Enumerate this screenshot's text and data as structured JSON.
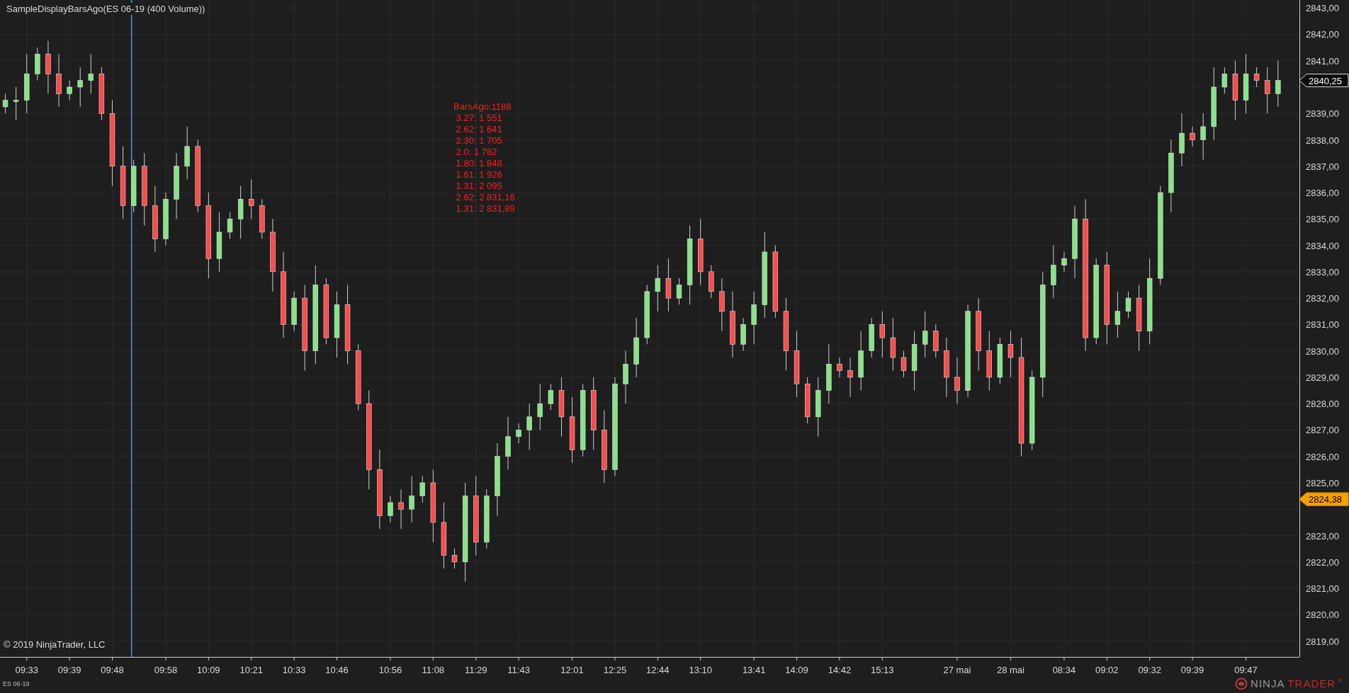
{
  "chart_title": "SampleDisplayBarsAgo(ES 06-19 (400 Volume))",
  "overlay_lines": [
    "BarsAgo:1188",
    " 3.27: 1 551",
    " 2.62: 1 641",
    " 2.30: 1 705",
    " 2.0: 1 782",
    " 1.80: 1 848",
    " 1.61: 1 926",
    " 1.31: 2 095",
    " 2.62: 2 831,16",
    " 1.31: 2 831,89"
  ],
  "copyright": "© 2019 NinjaTrader, LLC",
  "logo": {
    "part_1": "NINJA",
    "part_2": "TRADER",
    "mark": "®"
  },
  "chart_data": {
    "type": "candlestick",
    "grid": true,
    "ylim": [
      2818.4,
      2843.3
    ],
    "categories": [
      null,
      null,
      "09:33",
      null,
      null,
      null,
      "09:39",
      null,
      null,
      null,
      "09:48",
      null,
      null,
      null,
      null,
      "09:58",
      null,
      null,
      null,
      "10:09",
      null,
      null,
      null,
      "10:21",
      null,
      null,
      null,
      "10:33",
      null,
      null,
      null,
      "10:46",
      null,
      null,
      null,
      null,
      "10:56",
      null,
      null,
      null,
      "11:08",
      null,
      null,
      null,
      "11:29",
      null,
      null,
      null,
      "11:43",
      null,
      null,
      null,
      null,
      "12:01",
      null,
      null,
      null,
      "12:25",
      null,
      null,
      null,
      "12:44",
      null,
      null,
      null,
      "13:10",
      null,
      null,
      null,
      null,
      "13:41",
      null,
      null,
      null,
      "14:09",
      null,
      null,
      null,
      "14:42",
      null,
      null,
      null,
      "15:13",
      null,
      null,
      null,
      null,
      null,
      null,
      "27 mai",
      null,
      null,
      null,
      null,
      "28 mai",
      null,
      null,
      null,
      null,
      "08:34",
      null,
      null,
      null,
      "09:02",
      null,
      null,
      null,
      "09:32",
      null,
      null,
      null,
      "09:39",
      null,
      null,
      null,
      null,
      "09:47",
      null,
      null,
      null
    ],
    "series": [
      {
        "name": "ES 06-19",
        "ohlc": [
          [
            2839.25,
            2839.75,
            2839.0,
            2839.5
          ],
          [
            2839.5,
            2840.0,
            2838.75,
            2839.5
          ],
          [
            2839.5,
            2841.25,
            2839.0,
            2840.5
          ],
          [
            2840.5,
            2841.5,
            2840.25,
            2841.25
          ],
          [
            2841.25,
            2841.75,
            2839.75,
            2840.5
          ],
          [
            2840.5,
            2841.25,
            2839.25,
            2839.75
          ],
          [
            2839.75,
            2840.25,
            2839.5,
            2840.0
          ],
          [
            2840.0,
            2840.75,
            2839.25,
            2840.25
          ],
          [
            2840.25,
            2841.25,
            2839.75,
            2840.5
          ],
          [
            2840.5,
            2840.75,
            2838.75,
            2839.0
          ],
          [
            2839.0,
            2839.5,
            2836.25,
            2837.0
          ],
          [
            2837.0,
            2837.75,
            2835.0,
            2835.5
          ],
          [
            2835.5,
            2837.25,
            2835.25,
            2837.0
          ],
          [
            2837.0,
            2837.5,
            2834.75,
            2835.5
          ],
          [
            2835.5,
            2836.25,
            2833.75,
            2834.25
          ],
          [
            2834.25,
            2836.0,
            2834.0,
            2835.75
          ],
          [
            2835.75,
            2837.5,
            2835.0,
            2837.0
          ],
          [
            2837.0,
            2838.5,
            2836.5,
            2837.75
          ],
          [
            2837.75,
            2838.0,
            2835.25,
            2835.5
          ],
          [
            2835.5,
            2836.0,
            2832.75,
            2833.5
          ],
          [
            2833.5,
            2835.25,
            2833.0,
            2834.5
          ],
          [
            2834.5,
            2835.25,
            2834.25,
            2835.0
          ],
          [
            2835.0,
            2836.25,
            2834.25,
            2835.75
          ],
          [
            2835.75,
            2836.5,
            2835.0,
            2835.5
          ],
          [
            2835.5,
            2835.75,
            2834.25,
            2834.5
          ],
          [
            2834.5,
            2835.0,
            2832.25,
            2833.0
          ],
          [
            2833.0,
            2833.75,
            2830.5,
            2831.0
          ],
          [
            2831.0,
            2832.25,
            2830.75,
            2832.0
          ],
          [
            2832.0,
            2832.5,
            2829.25,
            2830.0
          ],
          [
            2830.0,
            2833.25,
            2829.5,
            2832.5
          ],
          [
            2832.5,
            2832.75,
            2830.25,
            2830.5
          ],
          [
            2830.5,
            2832.25,
            2829.75,
            2831.75
          ],
          [
            2831.75,
            2832.5,
            2829.5,
            2830.0
          ],
          [
            2830.0,
            2830.25,
            2827.75,
            2828.0
          ],
          [
            2828.0,
            2828.5,
            2824.75,
            2825.5
          ],
          [
            2825.5,
            2826.25,
            2823.25,
            2823.75
          ],
          [
            2823.75,
            2824.5,
            2823.5,
            2824.25
          ],
          [
            2824.25,
            2824.75,
            2823.25,
            2824.0
          ],
          [
            2824.0,
            2825.25,
            2823.5,
            2824.5
          ],
          [
            2824.5,
            2825.25,
            2824.25,
            2825.0
          ],
          [
            2825.0,
            2825.5,
            2822.75,
            2823.5
          ],
          [
            2823.5,
            2824.25,
            2821.75,
            2822.25
          ],
          [
            2822.25,
            2822.5,
            2821.75,
            2822.0
          ],
          [
            2822.0,
            2825.0,
            2821.25,
            2824.5
          ],
          [
            2824.5,
            2825.25,
            2822.25,
            2822.75
          ],
          [
            2822.75,
            2824.75,
            2822.5,
            2824.5
          ],
          [
            2824.5,
            2826.5,
            2823.75,
            2826.0
          ],
          [
            2826.0,
            2827.5,
            2825.5,
            2826.75
          ],
          [
            2826.75,
            2827.25,
            2826.5,
            2827.0
          ],
          [
            2827.0,
            2828.0,
            2826.25,
            2827.5
          ],
          [
            2827.5,
            2828.75,
            2827.0,
            2828.0
          ],
          [
            2828.0,
            2828.75,
            2827.75,
            2828.5
          ],
          [
            2828.5,
            2829.0,
            2826.75,
            2827.5
          ],
          [
            2827.5,
            2828.25,
            2825.75,
            2826.25
          ],
          [
            2826.25,
            2828.75,
            2826.0,
            2828.5
          ],
          [
            2828.5,
            2829.0,
            2826.25,
            2827.0
          ],
          [
            2827.0,
            2827.75,
            2825.0,
            2825.5
          ],
          [
            2825.5,
            2829.0,
            2825.25,
            2828.75
          ],
          [
            2828.75,
            2830.0,
            2828.0,
            2829.5
          ],
          [
            2829.5,
            2831.25,
            2829.0,
            2830.5
          ],
          [
            2830.5,
            2832.5,
            2830.25,
            2832.25
          ],
          [
            2832.25,
            2833.25,
            2831.5,
            2832.75
          ],
          [
            2832.75,
            2833.5,
            2831.5,
            2832.0
          ],
          [
            2832.0,
            2832.75,
            2831.75,
            2832.5
          ],
          [
            2832.5,
            2834.75,
            2831.75,
            2834.25
          ],
          [
            2834.25,
            2835.0,
            2832.5,
            2833.0
          ],
          [
            2833.0,
            2833.25,
            2832.0,
            2832.25
          ],
          [
            2832.25,
            2832.75,
            2830.75,
            2831.5
          ],
          [
            2831.5,
            2832.25,
            2829.75,
            2830.25
          ],
          [
            2830.25,
            2831.25,
            2830.0,
            2831.0
          ],
          [
            2831.0,
            2832.25,
            2830.25,
            2831.75
          ],
          [
            2831.75,
            2834.5,
            2831.25,
            2833.75
          ],
          [
            2833.75,
            2834.0,
            2831.25,
            2831.5
          ],
          [
            2831.5,
            2832.0,
            2829.25,
            2830.0
          ],
          [
            2830.0,
            2830.75,
            2828.25,
            2828.75
          ],
          [
            2828.75,
            2829.0,
            2827.25,
            2827.5
          ],
          [
            2827.5,
            2829.0,
            2826.75,
            2828.5
          ],
          [
            2828.5,
            2830.25,
            2828.0,
            2829.5
          ],
          [
            2829.5,
            2829.75,
            2829.0,
            2829.25
          ],
          [
            2829.25,
            2829.75,
            2828.25,
            2829.0
          ],
          [
            2829.0,
            2830.75,
            2828.5,
            2830.0
          ],
          [
            2830.0,
            2831.25,
            2829.75,
            2831.0
          ],
          [
            2831.0,
            2831.5,
            2829.75,
            2830.5
          ],
          [
            2830.5,
            2831.25,
            2829.25,
            2829.75
          ],
          [
            2829.75,
            2830.0,
            2829.0,
            2829.25
          ],
          [
            2829.25,
            2830.75,
            2828.5,
            2830.25
          ],
          [
            2830.25,
            2831.5,
            2829.75,
            2830.75
          ],
          [
            2830.75,
            2831.0,
            2829.75,
            2830.0
          ],
          [
            2830.0,
            2830.5,
            2828.25,
            2829.0
          ],
          [
            2829.0,
            2829.75,
            2828.0,
            2828.5
          ],
          [
            2828.5,
            2831.75,
            2828.25,
            2831.5
          ],
          [
            2831.5,
            2832.0,
            2829.25,
            2830.0
          ],
          [
            2830.0,
            2830.75,
            2828.5,
            2829.0
          ],
          [
            2829.0,
            2830.5,
            2828.75,
            2830.25
          ],
          [
            2830.25,
            2830.75,
            2829.0,
            2829.75
          ],
          [
            2829.75,
            2830.5,
            2826.0,
            2826.5
          ],
          [
            2826.5,
            2829.25,
            2826.25,
            2829.0
          ],
          [
            2829.0,
            2833.0,
            2828.25,
            2832.5
          ],
          [
            2832.5,
            2834.0,
            2832.0,
            2833.25
          ],
          [
            2833.25,
            2833.75,
            2833.0,
            2833.5
          ],
          [
            2833.5,
            2835.5,
            2832.75,
            2835.0
          ],
          [
            2835.0,
            2835.75,
            2830.0,
            2830.5
          ],
          [
            2830.5,
            2833.5,
            2830.25,
            2833.25
          ],
          [
            2833.25,
            2833.75,
            2830.25,
            2831.0
          ],
          [
            2831.0,
            2832.25,
            2830.5,
            2831.5
          ],
          [
            2831.5,
            2832.25,
            2831.25,
            2832.0
          ],
          [
            2832.0,
            2832.5,
            2830.0,
            2830.75
          ],
          [
            2830.75,
            2833.5,
            2830.25,
            2832.75
          ],
          [
            2832.75,
            2836.25,
            2832.5,
            2836.0
          ],
          [
            2836.0,
            2838.0,
            2835.25,
            2837.5
          ],
          [
            2837.5,
            2839.0,
            2837.0,
            2838.25
          ],
          [
            2838.25,
            2838.5,
            2837.75,
            2838.0
          ],
          [
            2838.0,
            2839.0,
            2837.25,
            2838.5
          ],
          [
            2838.5,
            2840.75,
            2838.0,
            2840.0
          ],
          [
            2840.0,
            2840.75,
            2839.75,
            2840.5
          ],
          [
            2840.5,
            2841.0,
            2838.75,
            2839.5
          ],
          [
            2839.5,
            2841.25,
            2839.0,
            2840.5
          ],
          [
            2840.5,
            2840.75,
            2840.0,
            2840.25
          ],
          [
            2840.25,
            2840.75,
            2839.0,
            2839.75
          ],
          [
            2839.75,
            2841.0,
            2839.25,
            2840.25
          ]
        ]
      }
    ],
    "yticks": [
      {
        "value": 2843,
        "label": "2843,00"
      },
      {
        "value": 2842,
        "label": "2842,00"
      },
      {
        "value": 2841,
        "label": "2841,00"
      },
      {
        "value": 2839,
        "label": "2839,00"
      },
      {
        "value": 2838,
        "label": "2838,00"
      },
      {
        "value": 2837,
        "label": "2837,00"
      },
      {
        "value": 2836,
        "label": "2836,00"
      },
      {
        "value": 2835,
        "label": "2835,00"
      },
      {
        "value": 2834,
        "label": "2834,00"
      },
      {
        "value": 2833,
        "label": "2833,00"
      },
      {
        "value": 2832,
        "label": "2832,00"
      },
      {
        "value": 2831,
        "label": "2831,00"
      },
      {
        "value": 2830,
        "label": "2830,00"
      },
      {
        "value": 2829,
        "label": "2829,00"
      },
      {
        "value": 2828,
        "label": "2828,00"
      },
      {
        "value": 2827,
        "label": "2827,00"
      },
      {
        "value": 2826,
        "label": "2826,00"
      },
      {
        "value": 2825,
        "label": "2825,00"
      },
      {
        "value": 2823,
        "label": "2823,00"
      },
      {
        "value": 2822,
        "label": "2822,00"
      },
      {
        "value": 2821,
        "label": "2821,00"
      },
      {
        "value": 2820,
        "label": "2820,00"
      },
      {
        "value": 2819,
        "label": "2819,00"
      }
    ]
  },
  "price_markers": [
    {
      "label": "2840,25",
      "color": "#0c0c0c"
    },
    {
      "label": "2824,38",
      "color": "#f5a000"
    }
  ]
}
